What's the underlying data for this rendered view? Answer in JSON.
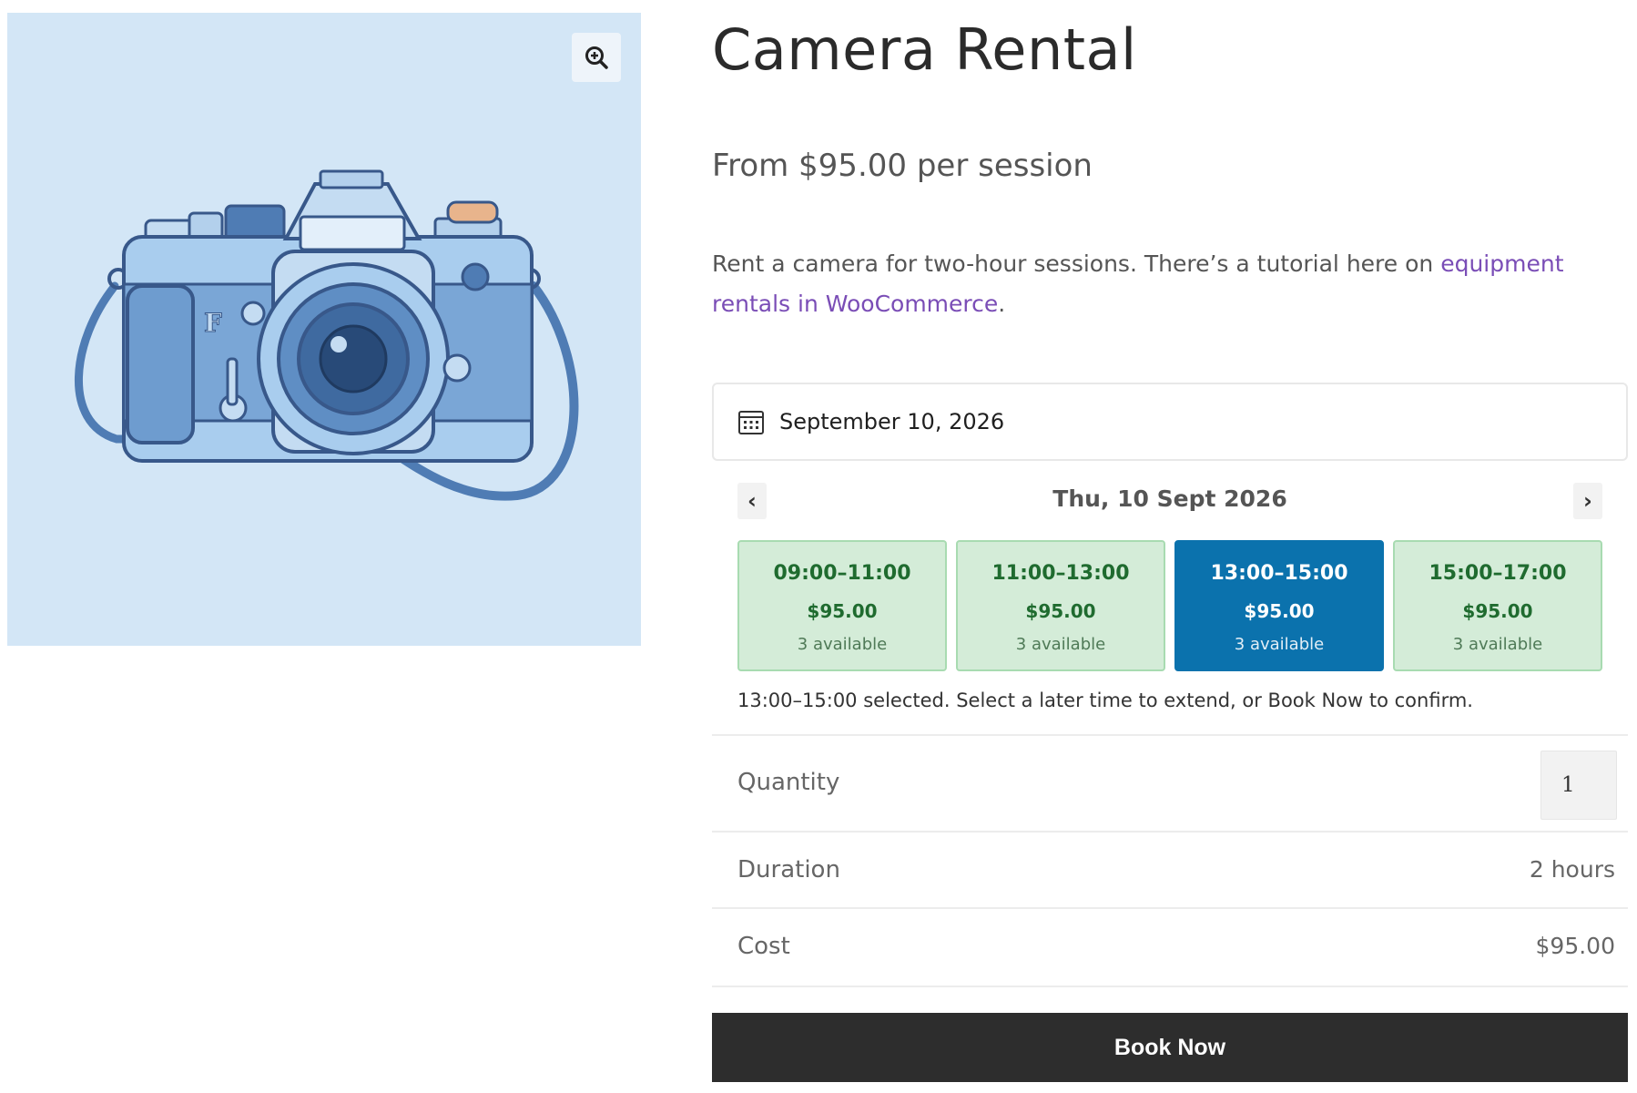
{
  "product": {
    "title": "Camera Rental",
    "price_text": "From $95.00 per session",
    "description_text": "Rent a camera for two-hour sessions. There’s a tutorial here on ",
    "description_link": "equipment rentals in WooCommerce",
    "description_end": "."
  },
  "image": {
    "background_color": "#d3e6f6",
    "zoom_icon": "magnifier-plus-icon"
  },
  "booking": {
    "date_value": "September 10, 2026",
    "calendar_icon": "calendar-icon",
    "day_label": "Thu, 10 Sept 2026",
    "prev_label": "‹",
    "next_label": "›",
    "slots": [
      {
        "time": "09:00–11:00",
        "price": "$95.00",
        "available": "3 available",
        "selected": false
      },
      {
        "time": "11:00–13:00",
        "price": "$95.00",
        "available": "3 available",
        "selected": false
      },
      {
        "time": "13:00–15:00",
        "price": "$95.00",
        "available": "3 available",
        "selected": true
      },
      {
        "time": "15:00–17:00",
        "price": "$95.00",
        "available": "3 available",
        "selected": false
      }
    ],
    "selection_note": "13:00–15:00 selected. Select a later time to extend, or Book Now to confirm."
  },
  "summary_rows": {
    "quantity_label": "Quantity",
    "quantity_value": "1",
    "duration_label": "Duration",
    "duration_value": "2 hours",
    "cost_label": "Cost",
    "cost_value": "$95.00"
  },
  "actions": {
    "book_now": "Book Now"
  },
  "colors": {
    "slot_available_bg": "#d4ecd8",
    "slot_selected_bg": "#0b72ad",
    "link": "#7a4db6",
    "button_bg": "#2d2d2d"
  }
}
